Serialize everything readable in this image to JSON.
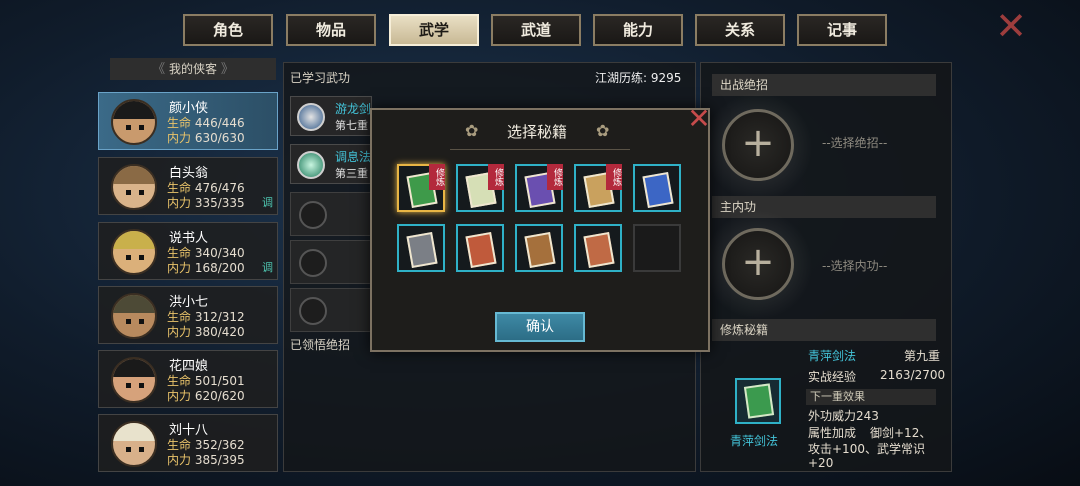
{
  "tabs": [
    {
      "label": "角色"
    },
    {
      "label": "物品"
    },
    {
      "label": "武学"
    },
    {
      "label": "武道"
    },
    {
      "label": "能力"
    },
    {
      "label": "关系"
    },
    {
      "label": "记事"
    }
  ],
  "hero_list": {
    "header": "我的侠客",
    "heroes": [
      {
        "name": "颜小侠",
        "hp": "446/446",
        "mp": "630/630",
        "tag": ""
      },
      {
        "name": "白头翁",
        "hp": "476/476",
        "mp": "335/335",
        "tag": "调"
      },
      {
        "name": "说书人",
        "hp": "340/340",
        "mp": "168/200",
        "tag": "调"
      },
      {
        "name": "洪小七",
        "hp": "312/312",
        "mp": "380/420",
        "tag": ""
      },
      {
        "name": "花四娘",
        "hp": "501/501",
        "mp": "620/620",
        "tag": ""
      },
      {
        "name": "刘十八",
        "hp": "352/362",
        "mp": "385/395",
        "tag": ""
      }
    ],
    "hp_label": "生命",
    "mp_label": "内力"
  },
  "middle": {
    "title": "已学习武功",
    "exp_label": "江湖历练: 9295",
    "skills": [
      {
        "name": "游龙剑",
        "stage": "第七重"
      },
      {
        "name": "调息法",
        "stage": "第三重"
      }
    ],
    "learned_title": "已领悟绝招"
  },
  "right": {
    "battle_title": "出战绝招",
    "battle_pick": "--选择绝招--",
    "internal_title": "主内功",
    "internal_pick": "--选择内功--",
    "train_title": "修炼秘籍",
    "manual_name": "青萍剑法",
    "manual_level": "第九重",
    "combat_exp_label": "实战经验",
    "combat_exp_value": "2163/2700",
    "next_effect": "下一重效果",
    "outer_power": "外功威力243",
    "attr_bonus_label": "属性加成",
    "attr_bonus_1": "御剑+12、",
    "attr_bonus_2": "攻击+100、武学常识",
    "attr_bonus_3": "+20"
  },
  "modal": {
    "title": "选择秘籍",
    "confirm": "确认",
    "training_mark": "修炼",
    "books": [
      {
        "color": "#3e9a4a",
        "training": true,
        "selected": true
      },
      {
        "color": "#d6dfb6",
        "training": true,
        "selected": false
      },
      {
        "color": "#6a4fb0",
        "training": true,
        "selected": false
      },
      {
        "color": "#c9a15e",
        "training": true,
        "selected": false
      },
      {
        "color": "#3c66c5",
        "training": false,
        "selected": false
      },
      {
        "color": "#7b7f86",
        "training": false,
        "selected": false
      },
      {
        "color": "#c05a3b",
        "training": false,
        "selected": false
      },
      {
        "color": "#a5703c",
        "training": false,
        "selected": false
      },
      {
        "color": "#c06a45",
        "training": false,
        "selected": false
      }
    ]
  }
}
